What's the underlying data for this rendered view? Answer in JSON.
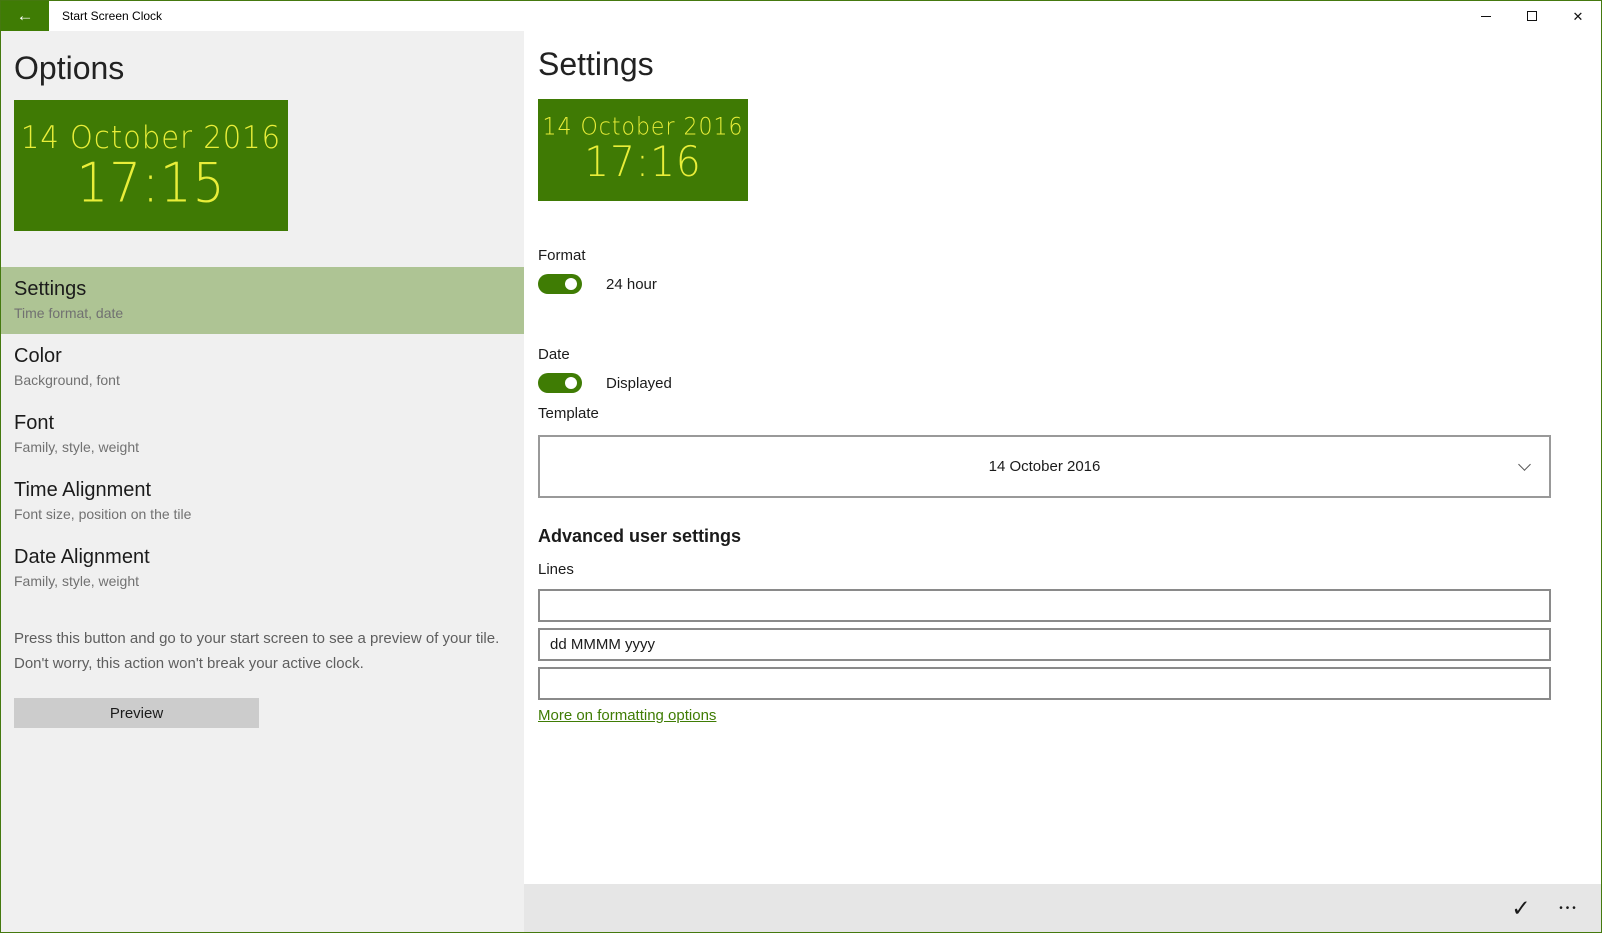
{
  "window": {
    "title": "Start Screen Clock"
  },
  "icons": {
    "back": "←",
    "minimize": "–",
    "maximize": "▢",
    "close": "✕",
    "chevron_down": "⌄",
    "accept": "✓",
    "more": "•••"
  },
  "colors": {
    "accent_green": "#3f7c04",
    "tile_background": "#3f7a04",
    "tile_text_yellow": "#e9ee39",
    "selected_item_background": "#aec494",
    "sidebar_background": "#f0f0f0",
    "command_bar_background": "#e6e6e6",
    "link_green": "#3f7c04"
  },
  "sidebar": {
    "heading": "Options",
    "tile": {
      "date": "14 October 2016",
      "time": "17:15"
    },
    "items": [
      {
        "label": "Settings",
        "description": "Time format, date",
        "selected": true
      },
      {
        "label": "Color",
        "description": "Background, font",
        "selected": false
      },
      {
        "label": "Font",
        "description": "Family, style, weight",
        "selected": false
      },
      {
        "label": "Time Alignment",
        "description": "Font size, position on the tile",
        "selected": false
      },
      {
        "label": "Date Alignment",
        "description": "Family, style, weight",
        "selected": false
      }
    ],
    "preview_note": "Press this button and go to your start screen to see a preview of your tile. Don't worry, this action won't break your active clock.",
    "preview_button": "Preview"
  },
  "main": {
    "heading": "Settings",
    "tile": {
      "date": "14 October 2016",
      "time": "17:16"
    },
    "format": {
      "label": "Format",
      "toggle_on": true,
      "value": "24 hour"
    },
    "date": {
      "label": "Date",
      "toggle_on": true,
      "value": "Displayed"
    },
    "template": {
      "label": "Template",
      "selected": "14 October 2016"
    },
    "advanced": {
      "heading": "Advanced user settings",
      "lines_label": "Lines",
      "lines": [
        "",
        "dd MMMM yyyy",
        ""
      ],
      "link": "More on formatting options"
    }
  }
}
